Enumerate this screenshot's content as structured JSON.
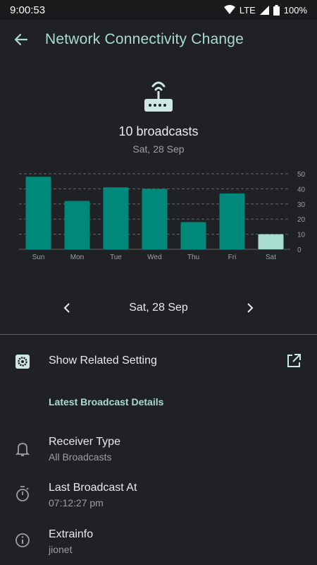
{
  "status_bar": {
    "time": "9:00:53",
    "network": "LTE",
    "battery": "100%"
  },
  "app_bar": {
    "title": "Network Connectivity Change"
  },
  "summary": {
    "count_label": "10 broadcasts",
    "date_label": "Sat, 28 Sep"
  },
  "chart_data": {
    "type": "bar",
    "categories": [
      "Sun",
      "Mon",
      "Tue",
      "Wed",
      "Thu",
      "Fri",
      "Sat"
    ],
    "values": [
      48,
      32,
      41,
      40,
      18,
      37,
      10
    ],
    "ylim": [
      0,
      50
    ],
    "yticks": [
      "50",
      "40",
      "30",
      "20",
      "10",
      "0"
    ],
    "grid": true,
    "colors": {
      "bar": "#00897b",
      "selected_bar": "#a8dcd1"
    },
    "selected_index": 6
  },
  "date_nav": {
    "date_label": "Sat, 28 Sep"
  },
  "related_setting": {
    "label": "Show Related Setting"
  },
  "details": {
    "header": "Latest Broadcast Details",
    "receiver_type": {
      "title": "Receiver Type",
      "value": "All Broadcasts"
    },
    "last_broadcast": {
      "title": "Last Broadcast At",
      "value": "07:12:27 pm"
    },
    "extra_info": {
      "title": "Extrainfo",
      "value": "jionet"
    }
  },
  "colors": {
    "accent": "#a8dcd1",
    "background": "#202124",
    "bar": "#00897b"
  }
}
